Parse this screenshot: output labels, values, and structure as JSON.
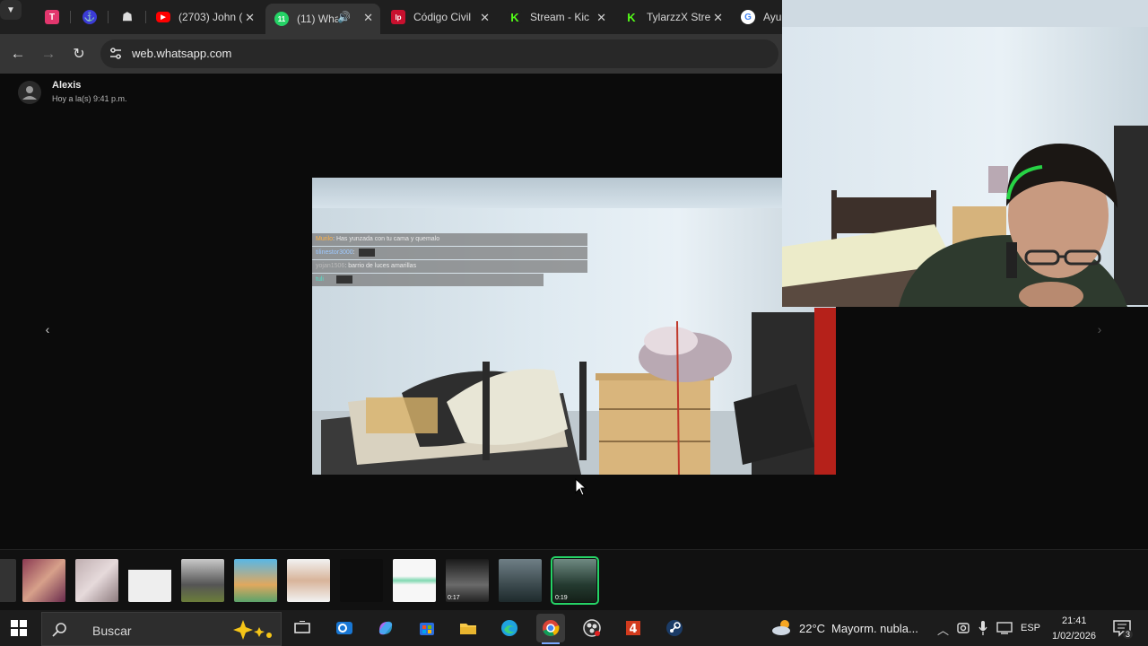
{
  "browser": {
    "tabs": [
      {
        "label": "",
        "favicon": "trello-like-icon",
        "color": "#e2366d"
      },
      {
        "label": "",
        "favicon": "anchor-icon",
        "color": "#3b3bd6"
      },
      {
        "label": "",
        "favicon": "cake-icon",
        "color": "#444444"
      },
      {
        "label": "(2703) John (",
        "favicon": "youtube-icon",
        "color": "#ff0000"
      },
      {
        "label": "(11) Wha",
        "favicon": "whatsapp-icon",
        "color": "#25d366",
        "active": true
      },
      {
        "label": "Código Civil",
        "favicon": "lp-icon",
        "color": "#c8102e"
      },
      {
        "label": "Stream - Kic",
        "favicon": "kick-icon",
        "color": "#53fc18"
      },
      {
        "label": "TylarzzX Stre",
        "favicon": "kick-icon",
        "color": "#53fc18"
      },
      {
        "label": "Ayud",
        "favicon": "google-icon",
        "color": "#4285f4"
      }
    ],
    "whatsapp_badge": "11",
    "lp_badge": "lp",
    "url": "web.whatsapp.com"
  },
  "viewer": {
    "sender_name": "Alexis",
    "sender_time": "Hoy a la(s) 9:41 p.m."
  },
  "stream_chat": [
    {
      "user": "Murilo",
      "msg": ": Has yunzada con tu cama y quemalo"
    },
    {
      "user": "tilinestor3000",
      "msg": ":"
    },
    {
      "user": "yojan1506",
      "msg": ": barrio de luces amarillas"
    },
    {
      "user": "tuli",
      "msg": ""
    }
  ],
  "thumbnails": [
    {
      "id": "t1",
      "duration": ""
    },
    {
      "id": "t2",
      "duration": ""
    },
    {
      "id": "t3",
      "duration": ""
    },
    {
      "id": "t4",
      "duration": ""
    },
    {
      "id": "t5",
      "duration": ""
    },
    {
      "id": "t6",
      "duration": ""
    },
    {
      "id": "t7",
      "duration": ""
    },
    {
      "id": "t8",
      "duration": ""
    },
    {
      "id": "t9",
      "duration": "0:17"
    },
    {
      "id": "t10",
      "duration": ""
    },
    {
      "id": "t11",
      "duration": "0:19",
      "selected": true
    }
  ],
  "taskbar": {
    "search_placeholder": "Buscar",
    "weather_temp": "22°C",
    "weather_desc": "Mayorm. nubla...",
    "language": "ESP",
    "time": "21:41",
    "date": "1/02/2026",
    "notification_count": "3"
  },
  "colors": {
    "whatsapp_green": "#25d366",
    "accent_blue": "#7aa7ff"
  }
}
